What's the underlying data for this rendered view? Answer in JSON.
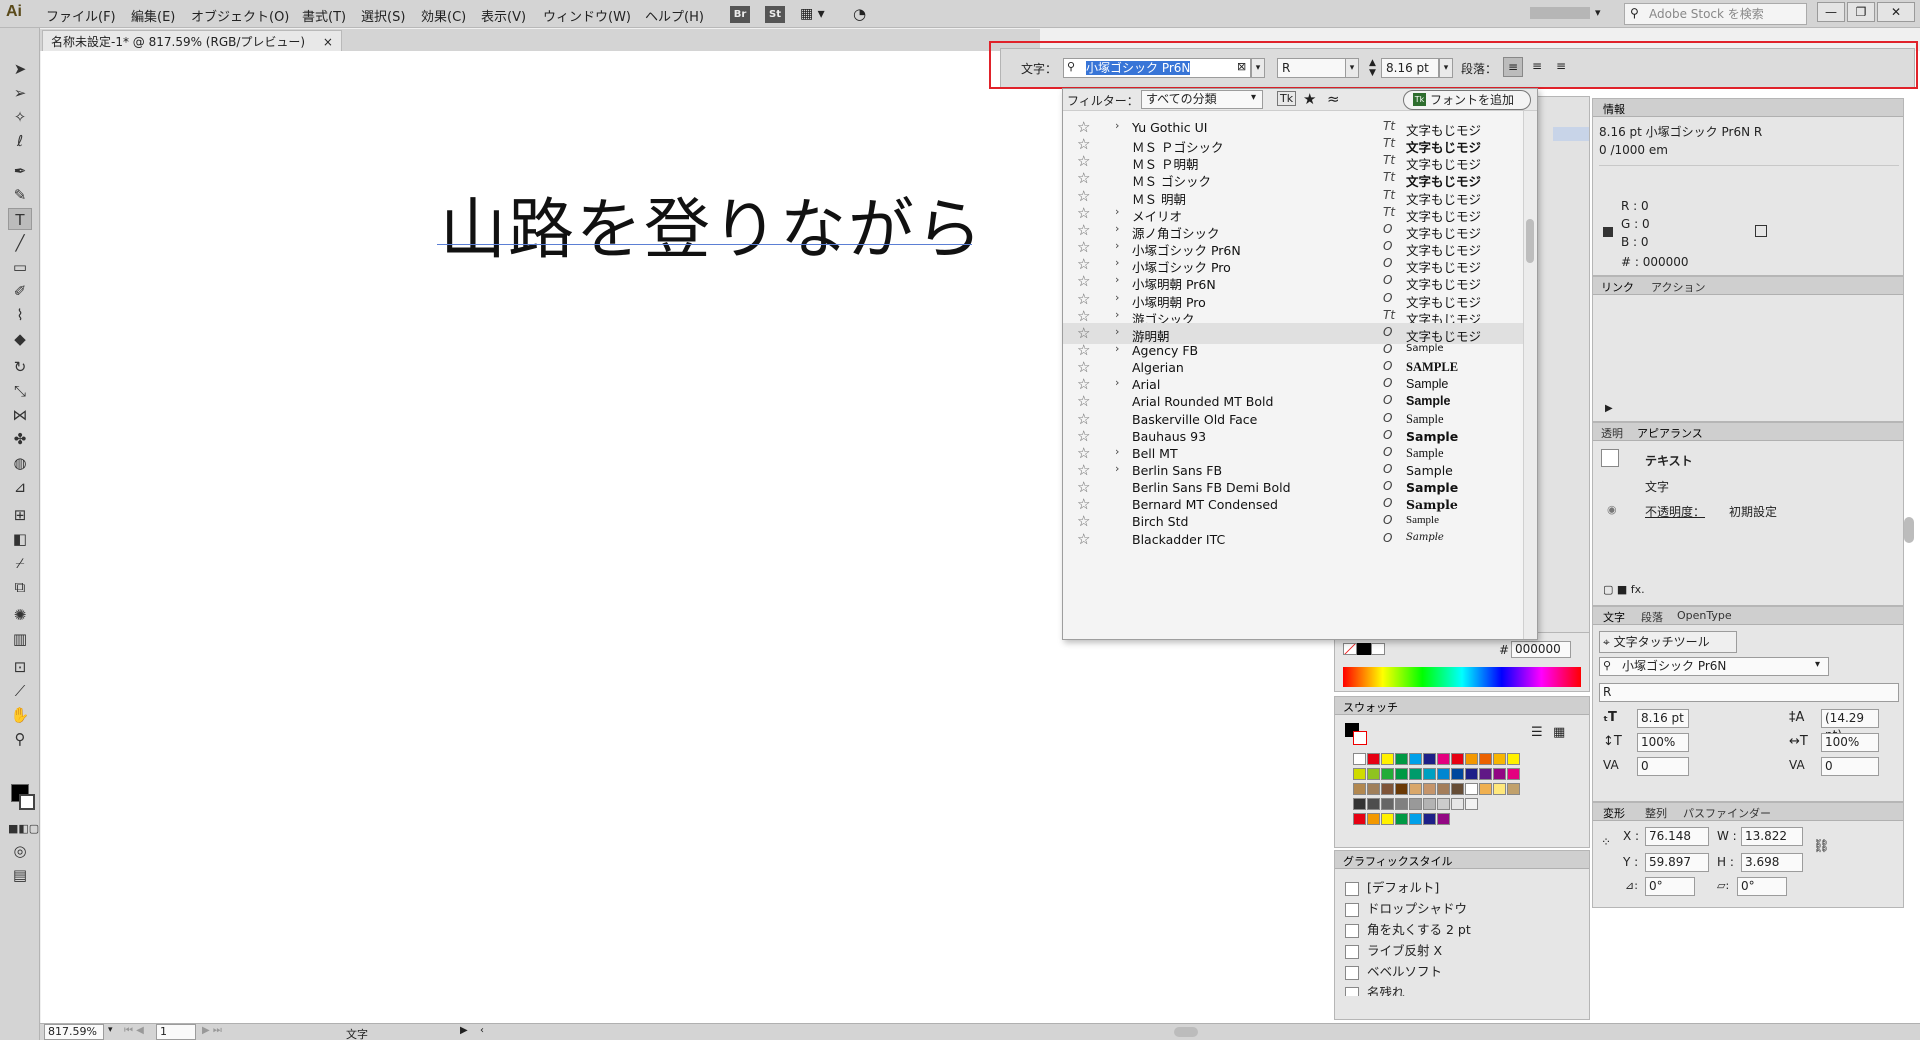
{
  "app": {
    "logo": "Ai"
  },
  "menu": [
    "ファイル(F)",
    "編集(E)",
    "オブジェクト(O)",
    "書式(T)",
    "選択(S)",
    "効果(C)",
    "表示(V)",
    "ウィンドウ(W)",
    "ヘルプ(H)"
  ],
  "menu_badges": [
    "Br",
    "St"
  ],
  "stock_search": {
    "placeholder": "Adobe Stock を検索"
  },
  "window_buttons": [
    "—",
    "❐",
    "✕"
  ],
  "document_tab": {
    "title": "名称未設定-1* @ 817.59% (RGB/プレビュー)",
    "close": "×"
  },
  "canvas": {
    "text": "山路を登りながら"
  },
  "control_bar": {
    "label": "文字：",
    "font_name": "小塚ゴシック Pr6N",
    "font_style": "R",
    "font_size": "8.16 pt",
    "paragraph_label": "段落："
  },
  "font_dropdown": {
    "filter_label": "フィルター：",
    "filter_value": "すべての分類",
    "add_fonts_button": "フォントを追加",
    "fonts": [
      {
        "name": "Yu Gothic UI",
        "expand": true,
        "type": "Tt",
        "sample": "文字もじモジ"
      },
      {
        "name": "ＭＳ Ｐゴシック",
        "expand": false,
        "type": "Tt",
        "sample": "文字もじモジ"
      },
      {
        "name": "ＭＳ Ｐ明朝",
        "expand": false,
        "type": "Tt",
        "sample": "文字もじモジ"
      },
      {
        "name": "ＭＳ ゴシック",
        "expand": false,
        "type": "Tt",
        "sample": "文字もじモジ"
      },
      {
        "name": "ＭＳ 明朝",
        "expand": false,
        "type": "Tt",
        "sample": "文字もじモジ"
      },
      {
        "name": "メイリオ",
        "expand": true,
        "type": "Tt",
        "sample": "文字もじモジ"
      },
      {
        "name": "源ノ角ゴシック",
        "expand": true,
        "type": "O",
        "sample": "文字もじモジ"
      },
      {
        "name": "小塚ゴシック Pr6N",
        "expand": true,
        "type": "O",
        "sample": "文字もじモジ"
      },
      {
        "name": "小塚ゴシック Pro",
        "expand": true,
        "type": "O",
        "sample": "文字もじモジ"
      },
      {
        "name": "小塚明朝 Pr6N",
        "expand": true,
        "type": "O",
        "sample": "文字もじモジ"
      },
      {
        "name": "小塚明朝 Pro",
        "expand": true,
        "type": "O",
        "sample": "文字もじモジ"
      },
      {
        "name": "游ゴシック",
        "expand": true,
        "type": "Tt",
        "sample": "文字もじモジ"
      },
      {
        "name": "游明朝",
        "expand": true,
        "type": "O",
        "sample": "文字もじモジ"
      },
      {
        "name": "Agency FB",
        "expand": true,
        "type": "O",
        "sample": "Sample"
      },
      {
        "name": "Algerian",
        "expand": false,
        "type": "O",
        "sample": "SAMPLE"
      },
      {
        "name": "Arial",
        "expand": true,
        "type": "O",
        "sample": "Sample"
      },
      {
        "name": "Arial Rounded MT Bold",
        "expand": false,
        "type": "O",
        "sample": "Sample"
      },
      {
        "name": "Baskerville Old Face",
        "expand": false,
        "type": "O",
        "sample": "Sample"
      },
      {
        "name": "Bauhaus 93",
        "expand": false,
        "type": "O",
        "sample": "Sample"
      },
      {
        "name": "Bell MT",
        "expand": true,
        "type": "O",
        "sample": "Sample"
      },
      {
        "name": "Berlin Sans FB",
        "expand": true,
        "type": "O",
        "sample": "Sample"
      },
      {
        "name": "Berlin Sans FB Demi Bold",
        "expand": false,
        "type": "O",
        "sample": "Sample"
      },
      {
        "name": "Bernard MT Condensed",
        "expand": false,
        "type": "O",
        "sample": "Sample"
      },
      {
        "name": "Birch Std",
        "expand": false,
        "type": "O",
        "sample": "Sample"
      },
      {
        "name": "Blackadder ITC",
        "expand": false,
        "type": "O",
        "sample": "Sample"
      }
    ]
  },
  "info_panel": {
    "tab": "情報",
    "line1": "8.16 pt 小塚ゴシック Pr6N R",
    "line2": "0 /1000 em",
    "r": "R : 0",
    "g": "G : 0",
    "b": "B : 0",
    "hex": "# : 000000"
  },
  "links_panel": {
    "tabs": [
      "リンク",
      "アクション"
    ]
  },
  "appearance_panel": {
    "tabs": [
      "透明",
      "アピアランス"
    ],
    "object": "テキスト",
    "item": "文字",
    "opacity_label": "不透明度：",
    "opacity_value": "初期設定"
  },
  "character_panel": {
    "tabs": [
      "文字",
      "段落",
      "OpenType"
    ],
    "touch_tool": "文字タッチツール",
    "font": "小塚ゴシック Pr6N",
    "style": "R",
    "size": "8.16 pt",
    "leading": "(14.29 pt)",
    "vscale": "100%",
    "hscale": "100%",
    "kerning": "0",
    "tracking": "0"
  },
  "transform_panel": {
    "tabs": [
      "変形",
      "整列",
      "パスファインダー"
    ],
    "x_label": "X :",
    "x": "76.148 mm",
    "y_label": "Y :",
    "y": "59.897 mm",
    "w_label": "W :",
    "w": "13.822 mm",
    "h_label": "H :",
    "h": "3.698 mm",
    "rotate": "0°",
    "shear": "0°"
  },
  "color_panel": {
    "hex_label": "#",
    "hex": "000000"
  },
  "swatches_panel": {
    "tab": "スウォッチ",
    "row1": [
      "#ffffff",
      "#e60012",
      "#fff100",
      "#009944",
      "#00a0e9",
      "#1d2088",
      "#e4007f",
      "#e60012",
      "#f39800",
      "#eb6100",
      "#f8b500",
      "#fff100"
    ],
    "row2": [
      "#cfdb00",
      "#8fc31f",
      "#22ac38",
      "#009944",
      "#009b6b",
      "#00a0c1",
      "#0086d1",
      "#00479d",
      "#1d2088",
      "#601986",
      "#920783",
      "#e4007f"
    ],
    "row3": [
      "#b28850",
      "#a0805b",
      "#7f5539",
      "#6a3906",
      "#d9a76a",
      "#c5956b",
      "#a47e5b",
      "#664d36",
      "#ffffff",
      "#f0b050",
      "#ffe87c",
      "#c1a16c"
    ],
    "row4": [
      "#333333",
      "#4d4d4d",
      "#666666",
      "#808080",
      "#999999",
      "#b3b3b3",
      "#cccccc",
      "#e6e6e6",
      "#f2f2f2"
    ],
    "row5": [
      "#e60012",
      "#f39800",
      "#fff100",
      "#009944",
      "#00a0e9",
      "#1d2088",
      "#920783"
    ]
  },
  "graphic_styles_panel": {
    "tab": "グラフィックスタイル",
    "items": [
      "[デフォルト]",
      "ドロップシャドウ",
      "角を丸くする 2 pt",
      "ライブ反射 X",
      "ベベルソフト",
      "名残れ"
    ]
  },
  "statusbar": {
    "zoom": "817.59%",
    "page": "1",
    "tool": "文字"
  }
}
